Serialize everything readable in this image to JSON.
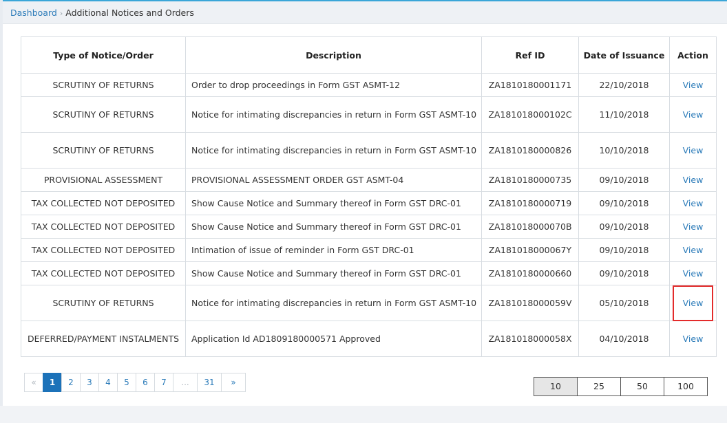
{
  "breadcrumb": {
    "home": "Dashboard",
    "current": "Additional Notices and Orders"
  },
  "table": {
    "headers": {
      "type": "Type of Notice/Order",
      "description": "Description",
      "ref_id": "Ref ID",
      "date": "Date of Issuance",
      "action": "Action"
    },
    "rows": [
      {
        "type": "SCRUTINY OF RETURNS",
        "description": "Order to drop proceedings in Form GST ASMT-12",
        "ref_id": "ZA1810180001171",
        "date": "22/10/2018",
        "action": "View"
      },
      {
        "type": "SCRUTINY OF RETURNS",
        "description": "Notice for intimating discrepancies in return in Form GST ASMT-10",
        "ref_id": "ZA181018000102C",
        "date": "11/10/2018",
        "action": "View"
      },
      {
        "type": "SCRUTINY OF RETURNS",
        "description": "Notice for intimating discrepancies in return in Form GST ASMT-10",
        "ref_id": "ZA1810180000826",
        "date": "10/10/2018",
        "action": "View"
      },
      {
        "type": "PROVISIONAL ASSESSMENT",
        "description": "PROVISIONAL ASSESSMENT ORDER GST ASMT-04",
        "ref_id": "ZA1810180000735",
        "date": "09/10/2018",
        "action": "View"
      },
      {
        "type": "TAX COLLECTED NOT DEPOSITED",
        "description": "Show Cause Notice and Summary thereof in Form GST DRC-01",
        "ref_id": "ZA1810180000719",
        "date": "09/10/2018",
        "action": "View"
      },
      {
        "type": "TAX COLLECTED NOT DEPOSITED",
        "description": "Show Cause Notice and Summary thereof in Form GST DRC-01",
        "ref_id": "ZA181018000070B",
        "date": "09/10/2018",
        "action": "View"
      },
      {
        "type": "TAX COLLECTED NOT DEPOSITED",
        "description": "Intimation of issue of reminder in Form GST DRC-01",
        "ref_id": "ZA181018000067Y",
        "date": "09/10/2018",
        "action": "View"
      },
      {
        "type": "TAX COLLECTED NOT DEPOSITED",
        "description": "Show Cause Notice and Summary thereof in Form GST DRC-01",
        "ref_id": "ZA1810180000660",
        "date": "09/10/2018",
        "action": "View"
      },
      {
        "type": "SCRUTINY OF RETURNS",
        "description": "Notice for intimating discrepancies in return in Form GST ASMT-10",
        "ref_id": "ZA181018000059V",
        "date": "05/10/2018",
        "action": "View"
      },
      {
        "type": "DEFERRED/PAYMENT INSTALMENTS",
        "description": "Application Id AD1809180000571 Approved",
        "ref_id": "ZA181018000058X",
        "date": "04/10/2018",
        "action": "View"
      }
    ]
  },
  "pagination": {
    "prev": "«",
    "pages": [
      "1",
      "2",
      "3",
      "4",
      "5",
      "6",
      "7"
    ],
    "ellipsis": "...",
    "last": "31",
    "next": "»",
    "active": "1"
  },
  "page_sizes": {
    "options": [
      "10",
      "25",
      "50",
      "100"
    ],
    "selected": "10"
  }
}
